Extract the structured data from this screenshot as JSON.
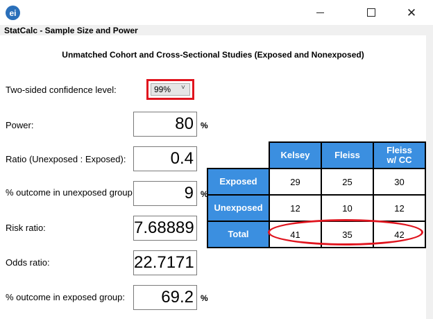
{
  "window": {
    "logo_text": "ei",
    "close_glyph": "✕"
  },
  "form": {
    "title": "StatCalc - Sample Size and Power",
    "heading": "Unmatched Cohort and Cross-Sectional Studies (Exposed and Nonexposed)"
  },
  "inputs": {
    "confidence": {
      "label": "Two-sided confidence level:",
      "value": "99%",
      "chevron": "˅"
    },
    "power": {
      "label": "Power:",
      "value": "80",
      "unit": "%"
    },
    "ratio": {
      "label": "Ratio (Unexposed : Exposed):",
      "value": "0.4"
    },
    "outcome_unexposed": {
      "label": "% outcome in unexposed group:",
      "value": "9",
      "unit": "%"
    },
    "risk_ratio": {
      "label": "Risk ratio:",
      "value": "7.68889"
    },
    "odds_ratio": {
      "label": "Odds ratio:",
      "value": "22.7171"
    },
    "outcome_exposed": {
      "label": "% outcome in exposed group:",
      "value": "69.2",
      "unit": "%"
    }
  },
  "results": {
    "columns": [
      "Kelsey",
      "Fleiss",
      "Fleiss",
      "w/ CC"
    ],
    "rows": [
      {
        "label": "Exposed",
        "kelsey": "29",
        "fleiss": "25",
        "fleiss_cc": "30"
      },
      {
        "label": "Unexposed",
        "kelsey": "12",
        "fleiss": "10",
        "fleiss_cc": "12"
      },
      {
        "label": "Total",
        "kelsey": "41",
        "fleiss": "35",
        "fleiss_cc": "42"
      }
    ]
  },
  "colors": {
    "header_blue": "#3b8fe0",
    "highlight_red": "#e0141e"
  }
}
